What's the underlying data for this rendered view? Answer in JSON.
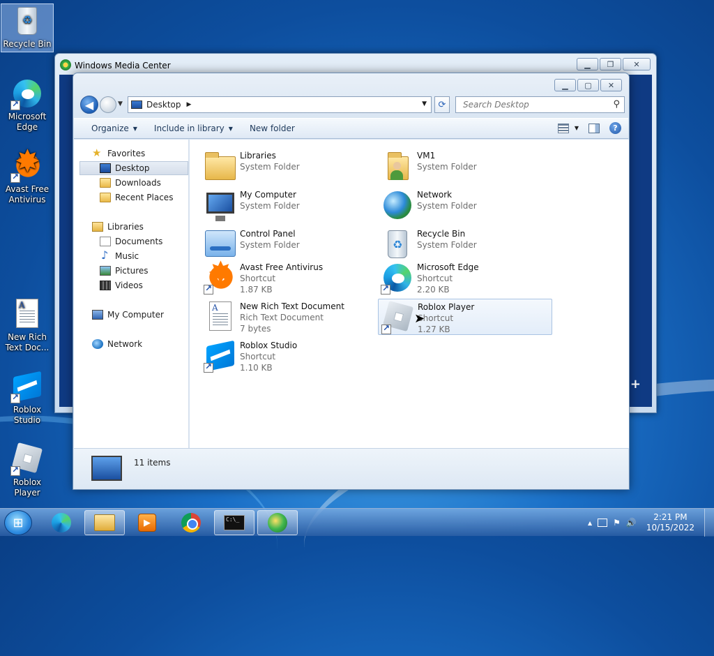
{
  "desktop": {
    "icons": [
      {
        "label": "Recycle Bin"
      },
      {
        "label": "Microsoft Edge"
      },
      {
        "label": "Avast Free Antivirus"
      },
      {
        "label": "New Rich Text Doc..."
      },
      {
        "label": "Roblox Studio"
      },
      {
        "label": "Roblox Player"
      }
    ]
  },
  "wmc_window": {
    "title": "Windows Media Center",
    "plus": "+"
  },
  "explorer": {
    "address": "Desktop",
    "search_placeholder": "Search Desktop",
    "toolbar": {
      "organize": "Organize",
      "include_in_library": "Include in library",
      "new_folder": "New folder"
    },
    "nav": {
      "favorites": "Favorites",
      "desktop": "Desktop",
      "downloads": "Downloads",
      "recent_places": "Recent Places",
      "libraries": "Libraries",
      "documents": "Documents",
      "music": "Music",
      "pictures": "Pictures",
      "videos": "Videos",
      "my_computer": "My Computer",
      "network": "Network"
    },
    "files": [
      {
        "name": "Libraries",
        "type": "System Folder",
        "size": ""
      },
      {
        "name": "VM1",
        "type": "System Folder",
        "size": ""
      },
      {
        "name": "My Computer",
        "type": "System Folder",
        "size": ""
      },
      {
        "name": "Network",
        "type": "System Folder",
        "size": ""
      },
      {
        "name": "Control Panel",
        "type": "System Folder",
        "size": ""
      },
      {
        "name": "Recycle Bin",
        "type": "System Folder",
        "size": ""
      },
      {
        "name": "Avast Free Antivirus",
        "type": "Shortcut",
        "size": "1.87 KB"
      },
      {
        "name": "Microsoft Edge",
        "type": "Shortcut",
        "size": "2.20 KB"
      },
      {
        "name": "New Rich Text Document",
        "type": "Rich Text Document",
        "size": "7 bytes"
      },
      {
        "name": "Roblox Player",
        "type": "Shortcut",
        "size": "1.27 KB"
      },
      {
        "name": "Roblox Studio",
        "type": "Shortcut",
        "size": "1.10 KB"
      }
    ],
    "status": "11 items"
  },
  "taskbar": {
    "cmd_text": "C:\\_",
    "clock_time": "2:21 PM",
    "clock_date": "10/15/2022",
    "tray_up": "▲",
    "tray_flag": "⚑",
    "tray_volume": "🔊"
  },
  "colors": {
    "accent": "#1a6fc7",
    "selection": "#a9c3e3"
  }
}
